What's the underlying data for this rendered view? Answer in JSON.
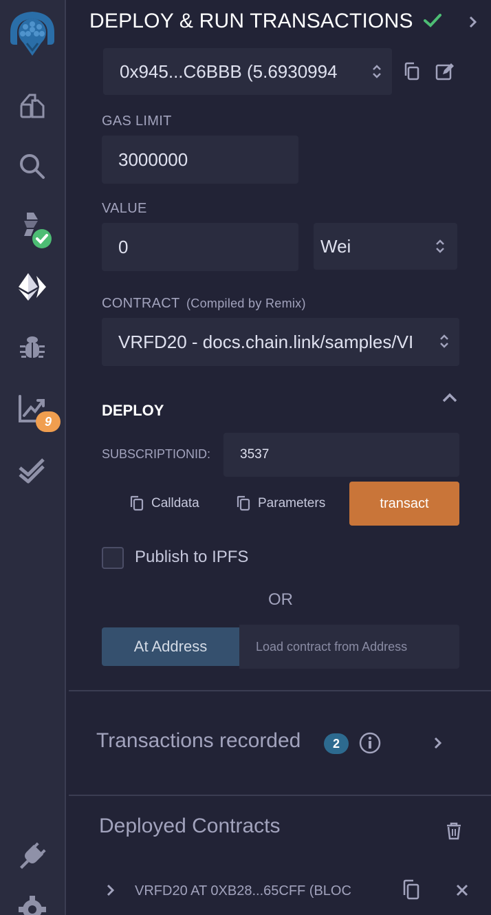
{
  "header": {
    "title": "DEPLOY & RUN TRANSACTIONS"
  },
  "account": {
    "value": "0x945...C6BBB (5.6930994"
  },
  "gas": {
    "label": "GAS LIMIT",
    "value": "3000000"
  },
  "value": {
    "label": "VALUE",
    "amount": "0",
    "unit": "Wei"
  },
  "contract": {
    "label": "CONTRACT",
    "sublabel": "(Compiled by Remix)",
    "selected": "VRFD20 - docs.chain.link/samples/VI"
  },
  "deploy": {
    "title": "DEPLOY",
    "param_label": "SUBSCRIPTIONID:",
    "param_value": "3537",
    "calldata_label": "Calldata",
    "parameters_label": "Parameters",
    "transact_label": "transact"
  },
  "publish": {
    "label": "Publish to IPFS"
  },
  "or_label": "OR",
  "at_address": {
    "button_label": "At Address",
    "placeholder": "Load contract from Address"
  },
  "transactions": {
    "label": "Transactions recorded",
    "count": "2"
  },
  "deployed": {
    "title": "Deployed Contracts",
    "items": [
      {
        "label": "VRFD20 AT 0XB28...65CFF (BLOC"
      }
    ]
  },
  "rail": {
    "analysis_badge": "9"
  },
  "colors": {
    "accent_orange": "#c97539",
    "success_green": "#4dbd74",
    "info_blue": "#2d6a8f",
    "brand_blue": "#2a6ea8"
  }
}
